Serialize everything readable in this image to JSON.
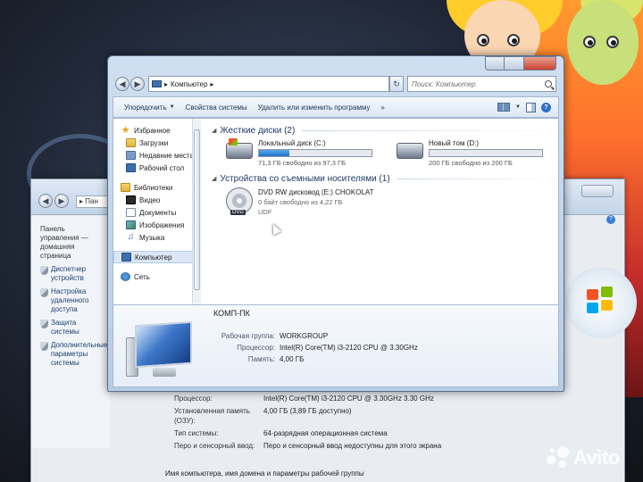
{
  "back_window": {
    "path_text": "▸ Пан",
    "left_items": [
      {
        "label": "Панель управления — домашняя страница",
        "icon": "none"
      },
      {
        "label": "Диспетчер устройств",
        "icon": "shield-icon"
      },
      {
        "label": "Настройка удаленного доступа",
        "icon": "shield-icon"
      },
      {
        "label": "Защита системы",
        "icon": "shield-icon"
      },
      {
        "label": "Дополнительные параметры системы",
        "icon": "shield-icon"
      }
    ],
    "info_rows": [
      {
        "key": "Процессор:",
        "value": "Intel(R) Core(TM) i3-2120 CPU @ 3.30GHz   3.30 GHz"
      },
      {
        "key": "Установленная память (ОЗУ):",
        "value": "4,00 ГБ (3,89 ГБ доступно)"
      },
      {
        "key": "Тип системы:",
        "value": "64-разрядная операционная система"
      },
      {
        "key": "Перо и сенсорный ввод:",
        "value": "Перо и сенсорный ввод недоступны для этого экрана"
      }
    ],
    "footer": "Имя компьютера, имя домена и параметры рабочей группы"
  },
  "window": {
    "address_parts": [
      "▸",
      "Компьютер",
      "▸"
    ],
    "search_placeholder": "Поиск: Компьютер",
    "toolbar": {
      "organize": "Упорядочить",
      "system_props": "Свойства системы",
      "uninstall": "Удалить или изменить программу",
      "more": "»"
    },
    "nav_pane": {
      "favorites_header": "Избранное",
      "favorites": [
        {
          "label": "Загрузки",
          "icon": "folder"
        },
        {
          "label": "Недавние места",
          "icon": "recent"
        },
        {
          "label": "Рабочий стол",
          "icon": "desk"
        }
      ],
      "libraries_header": "Библиотеки",
      "libraries": [
        {
          "label": "Видео",
          "icon": "video"
        },
        {
          "label": "Документы",
          "icon": "docs"
        },
        {
          "label": "Изображения",
          "icon": "pics"
        },
        {
          "label": "Музыка",
          "icon": "music"
        }
      ],
      "computer": "Компьютер",
      "network": "Сеть"
    },
    "groups": {
      "hard_disks": "Жесткие диски (2)",
      "removable": "Устройства со съемными носителями (1)"
    },
    "drives": [
      {
        "name": "Локальный диск (C:)",
        "free_text": "71,3 ГБ свободно из 97,3 ГБ",
        "used_fraction": 0.267,
        "system": true
      },
      {
        "name": "Новый том (D:)",
        "free_text": "200 ГБ свободно из 200 ГБ",
        "used_fraction": 0.0,
        "system": false
      }
    ],
    "dvd": {
      "name": "DVD RW дисковод (E:) CHOKOLAT",
      "free": "0 байт свободно из 4,22 ГБ",
      "fs": "UDF",
      "tag": "DVD"
    },
    "details": {
      "computer_name": "КОМП-ПК",
      "rows": [
        {
          "key": "Рабочая группа:",
          "value": "WORKGROUP"
        },
        {
          "key": "Процессор:",
          "value": "Intel(R) Core(TM) i3-2120 CPU @ 3.30GHz"
        },
        {
          "key": "Память:",
          "value": "4,00 ГБ"
        }
      ]
    }
  },
  "watermark": "Avito",
  "colors": {
    "progress_fill": "#1f73c9",
    "accent_blue": "#2f6ec7",
    "wallpaper_orange": "#ff6f2d"
  }
}
